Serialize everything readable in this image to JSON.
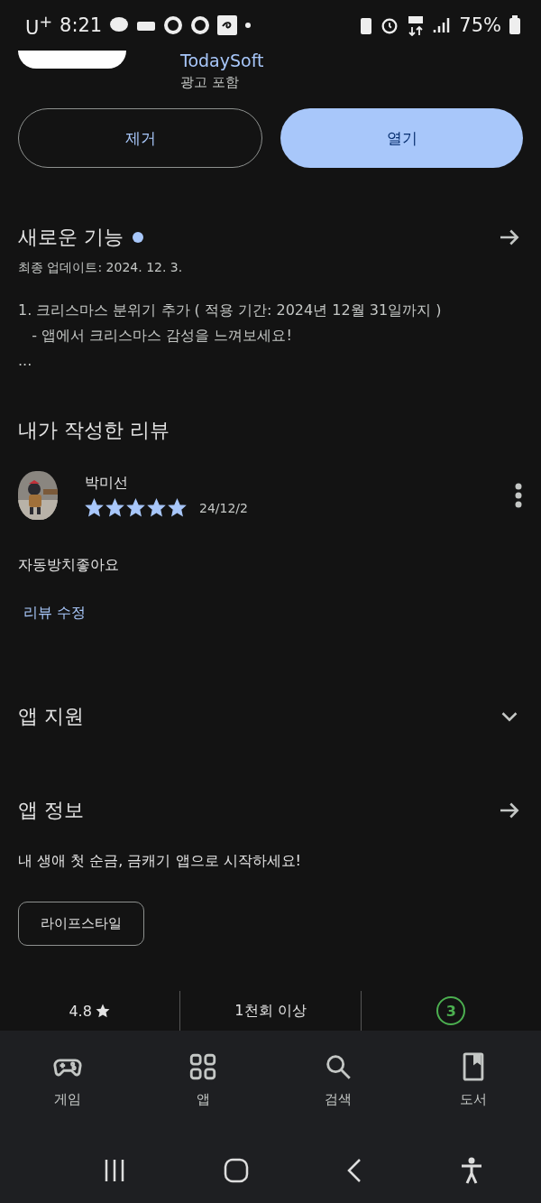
{
  "status_bar": {
    "carrier": "U$^{+}$",
    "time": "8:21",
    "battery": "75%"
  },
  "app": {
    "developer": "TodaySoft",
    "ads_note": "광고 포함"
  },
  "buttons": [
    {
      "label": "제거",
      "kind": "outline"
    },
    {
      "label": "열기",
      "kind": "filled"
    }
  ],
  "whats_new": {
    "title": "새로운 기능",
    "new_dot": true,
    "updated": "최종 업데이트: 2024. 12. 3.",
    "notes": [
      "1. 크리스마스 분위기 추가 ( 적용 기간: 2024년 12월 31일까지 )",
      "   - 앱에서 크리스마스 감성을 느껴보세요!",
      "..."
    ]
  },
  "my_review": {
    "title": "내가 작성한 리뷰",
    "author": "박미선",
    "stars": 5,
    "date": "24/12/2",
    "text": "자동방치좋아요",
    "edit_link": "리뷰 수정"
  },
  "app_support": {
    "title": "앱 지원",
    "expanded": false
  },
  "about": {
    "title": "앱 정보",
    "description": "내 생애 첫 순금, 금캐기 앱으로 시작하세요!",
    "tag": "라이프스타일"
  },
  "stats": {
    "rating": "4.8",
    "downloads": "1천회 이상",
    "content_rating": "3"
  },
  "bottom_nav": [
    {
      "label": "게임",
      "kind": "games"
    },
    {
      "label": "앱",
      "kind": "apps"
    },
    {
      "label": "검색",
      "kind": "search"
    },
    {
      "label": "도서",
      "kind": "books"
    }
  ]
}
